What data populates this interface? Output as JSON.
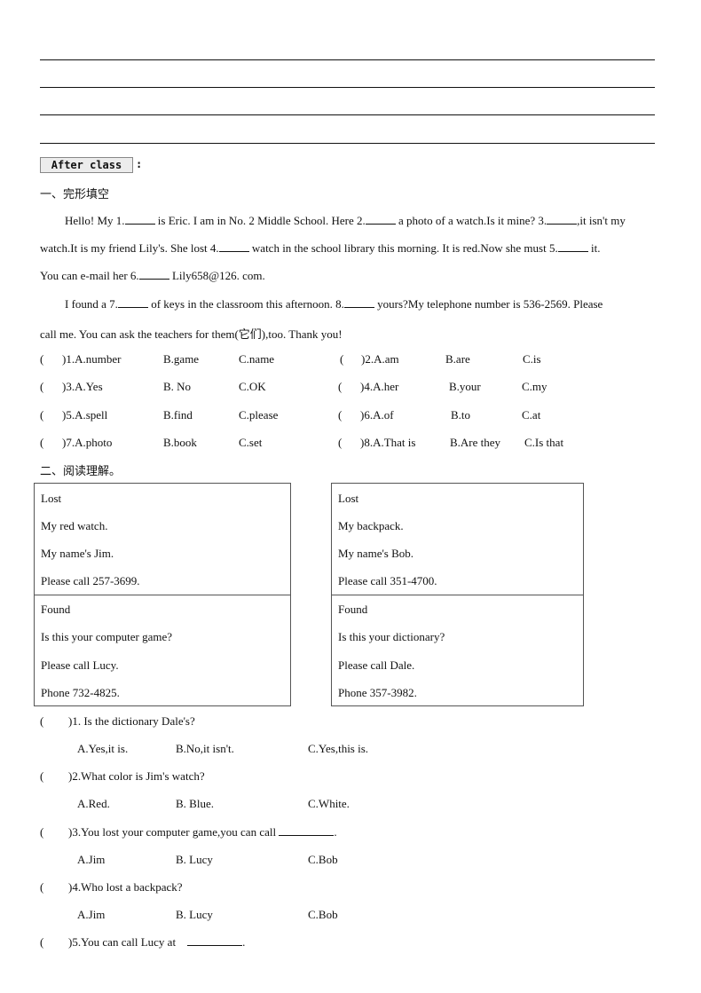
{
  "answer_lines_count": 4,
  "after_class": {
    "label": "After class",
    "colon": ":"
  },
  "cloze": {
    "title": "一、完形填空",
    "p1": {
      "l1a": "Hello!  My 1.",
      "l1b": " is Eric. I am in No. 2 Middle  School. Here 2.",
      "l1c": " a photo of a watch.Is it mine?  3.",
      "l1d": ",it isn't my",
      "l2a": "watch.It is my  friend Lily's.  She lost 4.",
      "l2b": " watch in the school library  this morning. It is red.Now she must 5.",
      "l2c": " it.",
      "l3a": "You  can e-mail her 6.",
      "l3b": " Lily658@126. com."
    },
    "p2": {
      "l1a": "I found a 7.",
      "l1b": " of keys in the classroom this afternoon. 8.",
      "l1c": " yours?My telephone number is 536-2569. Please",
      "l2": "call  me.  You  can ask the teachers for them(它们),too. Thank you!"
    },
    "options": [
      {
        "num": ")1.A.number",
        "b": "B.game",
        "c": "C.name"
      },
      {
        "num": ")2.A.am",
        "b": "B.are",
        "c": "C.is"
      },
      {
        "num": ")3.A.Yes",
        "b": "B.  No",
        "c": "C.OK"
      },
      {
        "num": ")4.A.her",
        "b": "B.your",
        "c": "C.my"
      },
      {
        "num": ")5.A.spell",
        "b": "B.find",
        "c": "C.please"
      },
      {
        "num": ")6.A.of",
        "b": "B.to",
        "c": "C.at"
      },
      {
        "num": ")7.A.photo",
        "b": "B.book",
        "c": "C.set"
      },
      {
        "num": ")8.A.That is",
        "b": "B.Are  they",
        "c": "C.Is that"
      }
    ],
    "paren": "("
  },
  "reading": {
    "title": "二、阅读理解。",
    "boxes": [
      {
        "lost": [
          "Lost",
          "My red watch.",
          "My name's Jim.",
          "Please  call  257-3699."
        ],
        "found": [
          "Found",
          "Is this your computer game?",
          "Please  call Lucy.",
          "Phone 732-4825."
        ]
      },
      {
        "lost": [
          "Lost",
          "My backpack.",
          "My name's Bob.",
          "Please  call  351-4700."
        ],
        "found": [
          "Found",
          "Is this your dictionary?",
          "Please  call Dale.",
          "Phone 357-3982."
        ]
      }
    ],
    "questions": [
      {
        "q": ")1.  Is the dictionary Dale's?",
        "a": "A.Yes,it  is.",
        "b": "B.No,it  isn't.",
        "c": "C.Yes,this is."
      },
      {
        "q": ")2.What color is Jim's watch?",
        "a": "A.Red.",
        "b": "B.  Blue.",
        "c": "C.White."
      },
      {
        "q": ")3.You lost your  computer game,you can call",
        "blank_after": ".",
        "a": "A.Jim",
        "b": "B.  Lucy",
        "c": "C.Bob"
      },
      {
        "q": ")4.Who lost a backpack?",
        "a": "A.Jim",
        "b": "B.  Lucy",
        "c": "C.Bob"
      },
      {
        "q": ")5.You can call Lucy at",
        "blank_after": "."
      }
    ],
    "paren": "("
  }
}
